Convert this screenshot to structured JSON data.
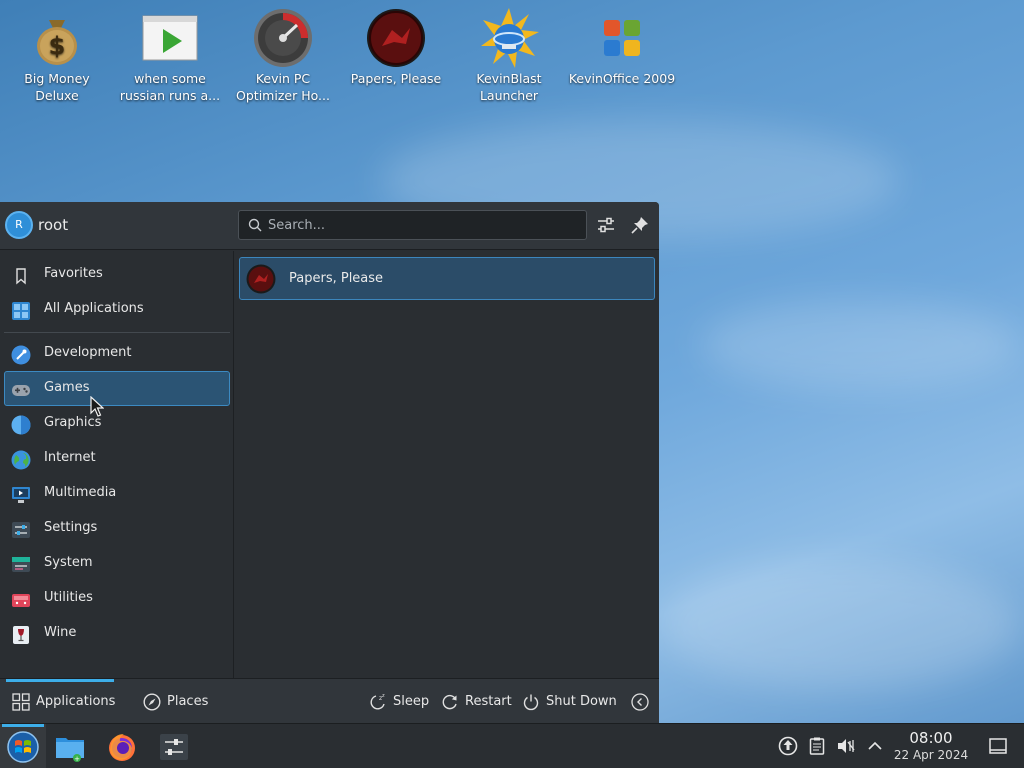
{
  "desktop": {
    "icons": [
      {
        "label": "Big Money Deluxe",
        "icon": "money-bag-icon"
      },
      {
        "label": "when some russian runs a...",
        "icon": "video-play-icon"
      },
      {
        "label": "Kevin PC Optimizer Ho...",
        "icon": "speedometer-icon"
      },
      {
        "label": "Papers, Please",
        "icon": "papers-please-icon"
      },
      {
        "label": "KevinBlast Launcher",
        "icon": "sun-globe-icon"
      },
      {
        "label": "KevinOffice 2009",
        "icon": "office-logo-icon"
      }
    ]
  },
  "launcher": {
    "user": {
      "initial": "R",
      "name": "root"
    },
    "search": {
      "placeholder": "Search...",
      "value": ""
    },
    "categories": [
      {
        "label": "Favorites",
        "icon": "bookmark-icon"
      },
      {
        "label": "All Applications",
        "icon": "grid-icon"
      },
      {
        "label": "Development",
        "icon": "development-icon"
      },
      {
        "label": "Games",
        "icon": "gamepad-icon",
        "active": true
      },
      {
        "label": "Graphics",
        "icon": "graphics-icon"
      },
      {
        "label": "Internet",
        "icon": "globe-icon"
      },
      {
        "label": "Multimedia",
        "icon": "multimedia-icon"
      },
      {
        "label": "Settings",
        "icon": "settings-icon"
      },
      {
        "label": "System",
        "icon": "system-icon"
      },
      {
        "label": "Utilities",
        "icon": "utilities-icon"
      },
      {
        "label": "Wine",
        "icon": "wine-icon"
      }
    ],
    "results": [
      {
        "label": "Papers, Please",
        "icon": "papers-please-icon"
      }
    ],
    "footer": {
      "tabs": [
        {
          "label": "Applications",
          "icon": "applications-grid-icon",
          "active": true
        },
        {
          "label": "Places",
          "icon": "compass-icon"
        }
      ],
      "power": [
        {
          "label": "Sleep",
          "icon": "sleep-icon"
        },
        {
          "label": "Restart",
          "icon": "restart-icon"
        },
        {
          "label": "Shut Down",
          "icon": "power-icon"
        }
      ]
    }
  },
  "taskbar": {
    "tasks": [
      {
        "name": "start-menu",
        "icon": "start-orb-icon"
      },
      {
        "name": "file-manager",
        "icon": "folder-icon"
      },
      {
        "name": "firefox",
        "icon": "firefox-icon"
      },
      {
        "name": "system-settings",
        "icon": "sliders-icon"
      }
    ],
    "clock": {
      "time": "08:00",
      "date": "22 Apr 2024"
    }
  },
  "colors": {
    "accent": "#3daee9",
    "panel": "#2a2e32",
    "header": "#31363b",
    "selection": "#2b5474"
  }
}
